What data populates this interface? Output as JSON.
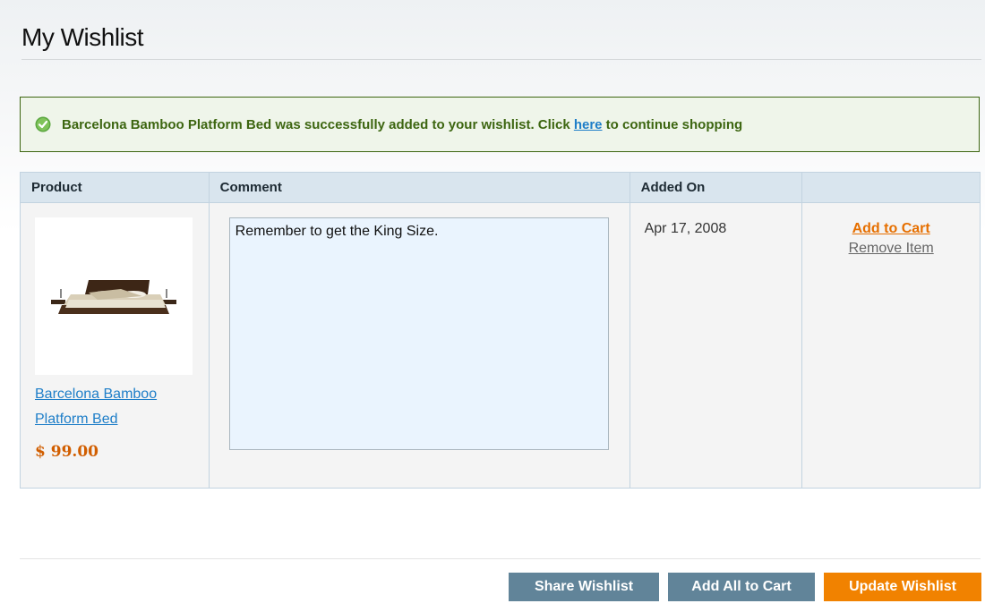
{
  "page": {
    "title": "My Wishlist"
  },
  "message": {
    "text_before": "Barcelona Bamboo Platform Bed was successfully added to your wishlist. Click ",
    "link_text": "here",
    "text_after": " to continue shopping",
    "icon": "check-circle-icon"
  },
  "table": {
    "headers": [
      "Product",
      "Comment",
      "Added On",
      ""
    ],
    "rows": [
      {
        "product_name_line1": "Barcelona Bamboo",
        "product_name_line2": "Platform Bed",
        "price": "$ 99.00",
        "comment": "Remember to get the King Size.",
        "added_on": "Apr 17, 2008",
        "add_to_cart": "Add to Cart",
        "remove_item": "Remove Item"
      }
    ]
  },
  "buttons": {
    "share": "Share Wishlist",
    "add_all": "Add All to Cart",
    "update": "Update Wishlist"
  },
  "colors": {
    "success_text": "#3d6611",
    "link": "#1e7ec8",
    "price": "#d15e00",
    "primary_button": "#f18200",
    "secondary_button": "#618499"
  }
}
